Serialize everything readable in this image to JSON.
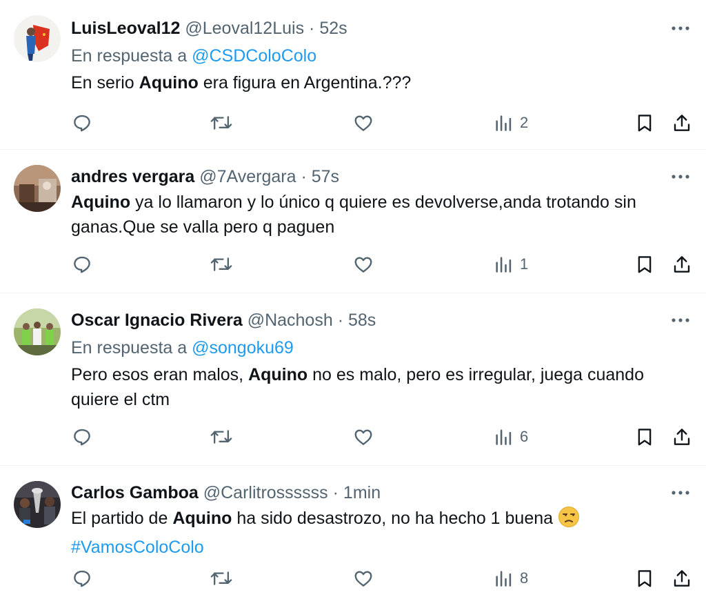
{
  "tweets": [
    {
      "display_name": "LuisLeoval12",
      "handle": "@Leoval12Luis",
      "separator": "·",
      "time": "52s",
      "reply_prefix": "En respuesta a",
      "reply_to": "@CSDColoColo",
      "text_before": "En serio ",
      "text_bold": "Aquino",
      "text_after": " era figura en Argentina.???",
      "views": "2"
    },
    {
      "display_name": "andres vergara",
      "handle": "@7Avergara",
      "separator": "·",
      "time": "57s",
      "text_before": "",
      "text_bold": "Aquino",
      "text_after": " ya lo llamaron y lo único q quiere es devolverse,anda trotando sin ganas.Que se valla pero q paguen",
      "views": "1"
    },
    {
      "display_name": "Oscar Ignacio Rivera",
      "handle": "@Nachosh",
      "separator": "·",
      "time": "58s",
      "reply_prefix": "En respuesta a",
      "reply_to": "@songoku69",
      "text_before": "Pero esos eran malos, ",
      "text_bold": "Aquino",
      "text_after": " no es malo, pero es irregular, juega cuando quiere el ctm",
      "views": "6"
    },
    {
      "display_name": "Carlos Gamboa",
      "handle": "@Carlitrossssss",
      "separator": "·",
      "time": "1min",
      "text_before": "El partido de ",
      "text_bold": "Aquino",
      "text_after": " ha sido desastrozo, no ha hecho 1 buena ",
      "emoji": "unamused-face",
      "hashtag": "#VamosColoColo",
      "views": "8"
    }
  ],
  "icons": {
    "reply": "reply-icon",
    "retweet": "retweet-icon",
    "like": "like-icon",
    "views": "views-icon",
    "bookmark": "bookmark-icon",
    "share": "share-icon",
    "more": "more-icon"
  },
  "colors": {
    "link": "#1d9bf0",
    "secondary_text": "#536471",
    "primary_text": "#0f1419",
    "divider": "#eff3f4"
  }
}
